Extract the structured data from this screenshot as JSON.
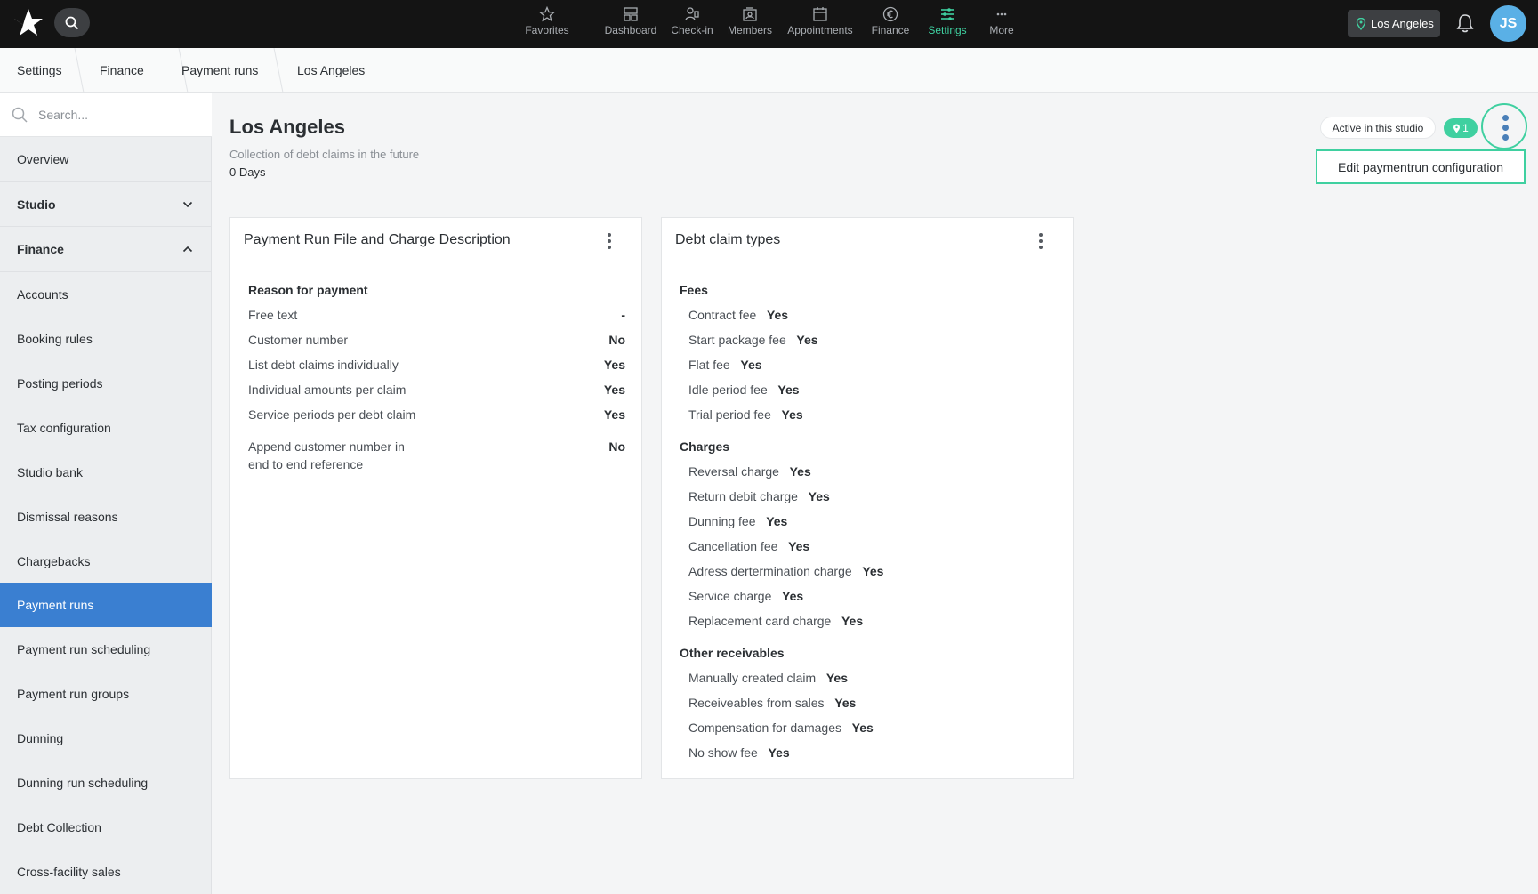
{
  "topbar": {
    "nav": [
      {
        "label": "Favorites",
        "icon": "star-icon"
      },
      {
        "label": "Dashboard",
        "icon": "dashboard-icon"
      },
      {
        "label": "Check-in",
        "icon": "check-in-icon"
      },
      {
        "label": "Members",
        "icon": "members-icon"
      },
      {
        "label": "Appointments",
        "icon": "calendar-icon"
      },
      {
        "label": "Finance",
        "icon": "euro-icon"
      },
      {
        "label": "Settings",
        "icon": "sliders-icon"
      },
      {
        "label": "More",
        "icon": "more-icon"
      }
    ],
    "active_nav": "Settings",
    "location": "Los Angeles",
    "avatar_initials": "JS"
  },
  "breadcrumb": [
    "Settings",
    "Finance",
    "Payment runs",
    "Los Angeles"
  ],
  "sidebar": {
    "search_placeholder": "Search...",
    "items": [
      {
        "label": "Overview"
      },
      {
        "label": "Studio",
        "section": true,
        "chevron": "down"
      },
      {
        "label": "Finance",
        "section": true,
        "chevron": "up"
      },
      {
        "label": "Accounts"
      },
      {
        "label": "Booking rules"
      },
      {
        "label": "Posting periods"
      },
      {
        "label": "Tax configuration"
      },
      {
        "label": "Studio bank"
      },
      {
        "label": "Dismissal reasons"
      },
      {
        "label": "Chargebacks"
      },
      {
        "label": "Payment runs",
        "active": true
      },
      {
        "label": "Payment run scheduling"
      },
      {
        "label": "Payment run groups"
      },
      {
        "label": "Dunning"
      },
      {
        "label": "Dunning run scheduling"
      },
      {
        "label": "Debt Collection"
      },
      {
        "label": "Cross-facility sales"
      }
    ]
  },
  "main": {
    "title": "Los Angeles",
    "subtitle": "Collection of debt claims in the future",
    "days": "0 Days",
    "active_badge": "Active in this studio",
    "count_badge": "1",
    "dropdown_item": "Edit paymentrun configuration"
  },
  "card1": {
    "title": "Payment Run File and Charge Description",
    "group": "Reason for payment",
    "rows": [
      {
        "label": "Free text",
        "value": "-"
      },
      {
        "label": "Customer number",
        "value": "No"
      },
      {
        "label": "List debt claims individually",
        "value": "Yes"
      },
      {
        "label": "Individual amounts per claim",
        "value": "Yes"
      },
      {
        "label": "Service periods per debt claim",
        "value": "Yes"
      }
    ],
    "multiline_row": {
      "line1": "Append customer number in",
      "line2": "end to end reference",
      "value": "No"
    }
  },
  "card2": {
    "title": "Debt claim types",
    "groups": [
      {
        "name": "Fees",
        "rows": [
          {
            "label": "Contract fee",
            "value": "Yes"
          },
          {
            "label": "Start package fee",
            "value": "Yes"
          },
          {
            "label": "Flat fee",
            "value": "Yes"
          },
          {
            "label": "Idle period fee",
            "value": "Yes"
          },
          {
            "label": "Trial period fee",
            "value": "Yes"
          }
        ]
      },
      {
        "name": "Charges",
        "rows": [
          {
            "label": "Reversal charge",
            "value": "Yes"
          },
          {
            "label": "Return debit charge",
            "value": "Yes"
          },
          {
            "label": "Dunning fee",
            "value": "Yes"
          },
          {
            "label": "Cancellation fee",
            "value": "Yes"
          },
          {
            "label": "Adress dertermination charge",
            "value": "Yes"
          },
          {
            "label": "Service charge",
            "value": "Yes"
          },
          {
            "label": "Replacement card charge",
            "value": "Yes"
          }
        ]
      },
      {
        "name": "Other receivables",
        "rows": [
          {
            "label": "Manually created claim",
            "value": "Yes"
          },
          {
            "label": "Receiveables from sales",
            "value": "Yes"
          },
          {
            "label": "Compensation for damages",
            "value": "Yes"
          },
          {
            "label": "No show fee",
            "value": "Yes"
          }
        ]
      }
    ]
  },
  "colors": {
    "accent": "#3fd0a0",
    "active_item": "#3a7fd1",
    "topbar": "#141414"
  }
}
